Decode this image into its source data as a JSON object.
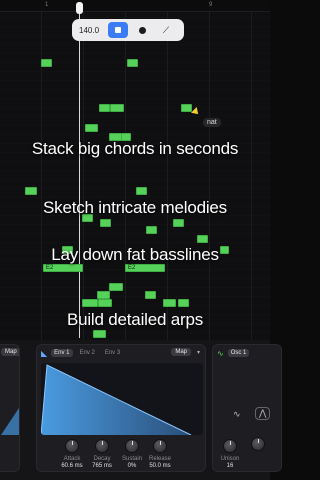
{
  "ruler": {
    "bar_1": "1",
    "bar_9": "9"
  },
  "toolbar": {
    "tempo": "140.0"
  },
  "tooltip": {
    "text": "nat"
  },
  "notes": [
    {
      "label": ""
    },
    {
      "label": ""
    },
    {
      "label": ""
    },
    {
      "label": ""
    },
    {
      "label": ""
    },
    {
      "label": ""
    },
    {
      "label": ""
    },
    {
      "label": ""
    },
    {
      "label": ""
    },
    {
      "label": ""
    },
    {
      "label": ""
    },
    {
      "label": ""
    },
    {
      "label": ""
    },
    {
      "label": ""
    },
    {
      "label": ""
    },
    {
      "label": ""
    },
    {
      "label": ""
    },
    {
      "label": "E2"
    },
    {
      "label": "E2"
    },
    {
      "label": ""
    },
    {
      "label": ""
    },
    {
      "label": ""
    },
    {
      "label": ""
    },
    {
      "label": ""
    },
    {
      "label": ""
    },
    {
      "label": ""
    },
    {
      "label": ""
    }
  ],
  "captions": {
    "line1": "Stack big chords in seconds",
    "line2": "Sketch intricate melodies",
    "line3": "Lay down fat basslines",
    "line4": "Build detailed arps"
  },
  "panel_left": {
    "map": "Map"
  },
  "panel_env": {
    "tabs": [
      "Env 1",
      "Env 2",
      "Env 3"
    ],
    "map": "Map",
    "knobs": [
      {
        "label": "Attack",
        "value": "60.6 ms"
      },
      {
        "label": "Decay",
        "value": "765 ms"
      },
      {
        "label": "Sustain",
        "value": "0%"
      },
      {
        "label": "Release",
        "value": "50.0 ms"
      }
    ]
  },
  "panel_osc": {
    "tab": "Osc 1",
    "knobs": [
      {
        "label": "Unison",
        "value": "16"
      }
    ]
  },
  "colors": {
    "note": "#56d15a",
    "accent": "#3b7bf6",
    "env_fill": "#3f86c8"
  },
  "icons": [
    "play-square-icon",
    "record-dot-icon",
    "magic-wand-icon",
    "envelope-icon",
    "oscillator-icon",
    "sine-wave-icon",
    "saw-wave-icon"
  ]
}
